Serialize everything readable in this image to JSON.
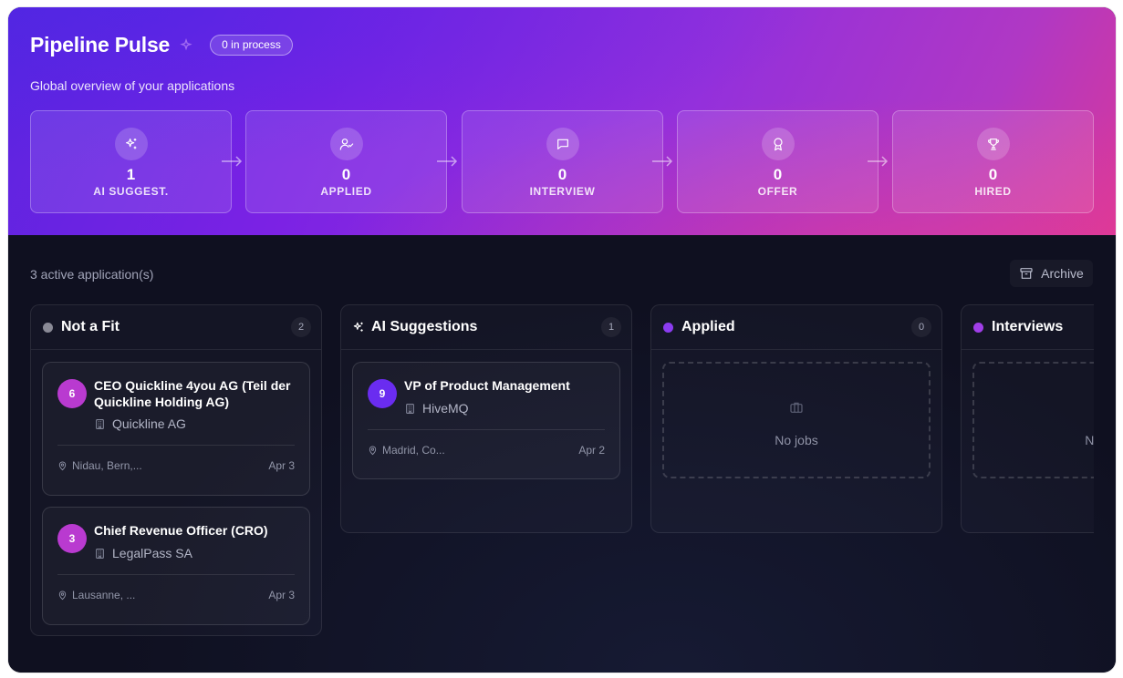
{
  "header": {
    "title": "Pipeline Pulse",
    "badge": "0 in process",
    "subtitle": "Global overview of your applications"
  },
  "stages": [
    {
      "count": "1",
      "label": "AI SUGGEST.",
      "icon": "sparkles-icon"
    },
    {
      "count": "0",
      "label": "APPLIED",
      "icon": "user-check-icon"
    },
    {
      "count": "0",
      "label": "INTERVIEW",
      "icon": "chat-bubble-icon"
    },
    {
      "count": "0",
      "label": "OFFER",
      "icon": "award-icon"
    },
    {
      "count": "0",
      "label": "HIRED",
      "icon": "trophy-icon"
    }
  ],
  "board": {
    "active_count": "3 active application(s)",
    "archive_label": "Archive"
  },
  "columns": [
    {
      "title": "Not a Fit",
      "count": "2",
      "dot_color": "#8a8a96",
      "cards": [
        {
          "score": "6",
          "title": "CEO Quickline 4you AG (Teil der Quickline Holding AG)",
          "company": "Quickline AG",
          "location": "Nidau, Bern,...",
          "date": "Apr 3"
        },
        {
          "score": "3",
          "title": "Chief Revenue Officer (CRO)",
          "company": "LegalPass SA",
          "location": "Lausanne, ...",
          "date": "Apr 3"
        }
      ]
    },
    {
      "title": "AI Suggestions",
      "count": "1",
      "icon": "sparkles-icon",
      "cards": [
        {
          "score": "9",
          "title": "VP of Product Management",
          "company": "HiveMQ",
          "location": "Madrid, Co...",
          "date": "Apr 2"
        }
      ]
    },
    {
      "title": "Applied",
      "count": "0",
      "dot_color": "#8b3cf0",
      "empty_text": "No jobs"
    },
    {
      "title": "Interviews",
      "dot_color": "#a03ee8",
      "empty_text": "No jobs"
    }
  ],
  "colors": {
    "score_not_fit": "#b93ad0",
    "score_suggestion": "#6a2cf0"
  }
}
